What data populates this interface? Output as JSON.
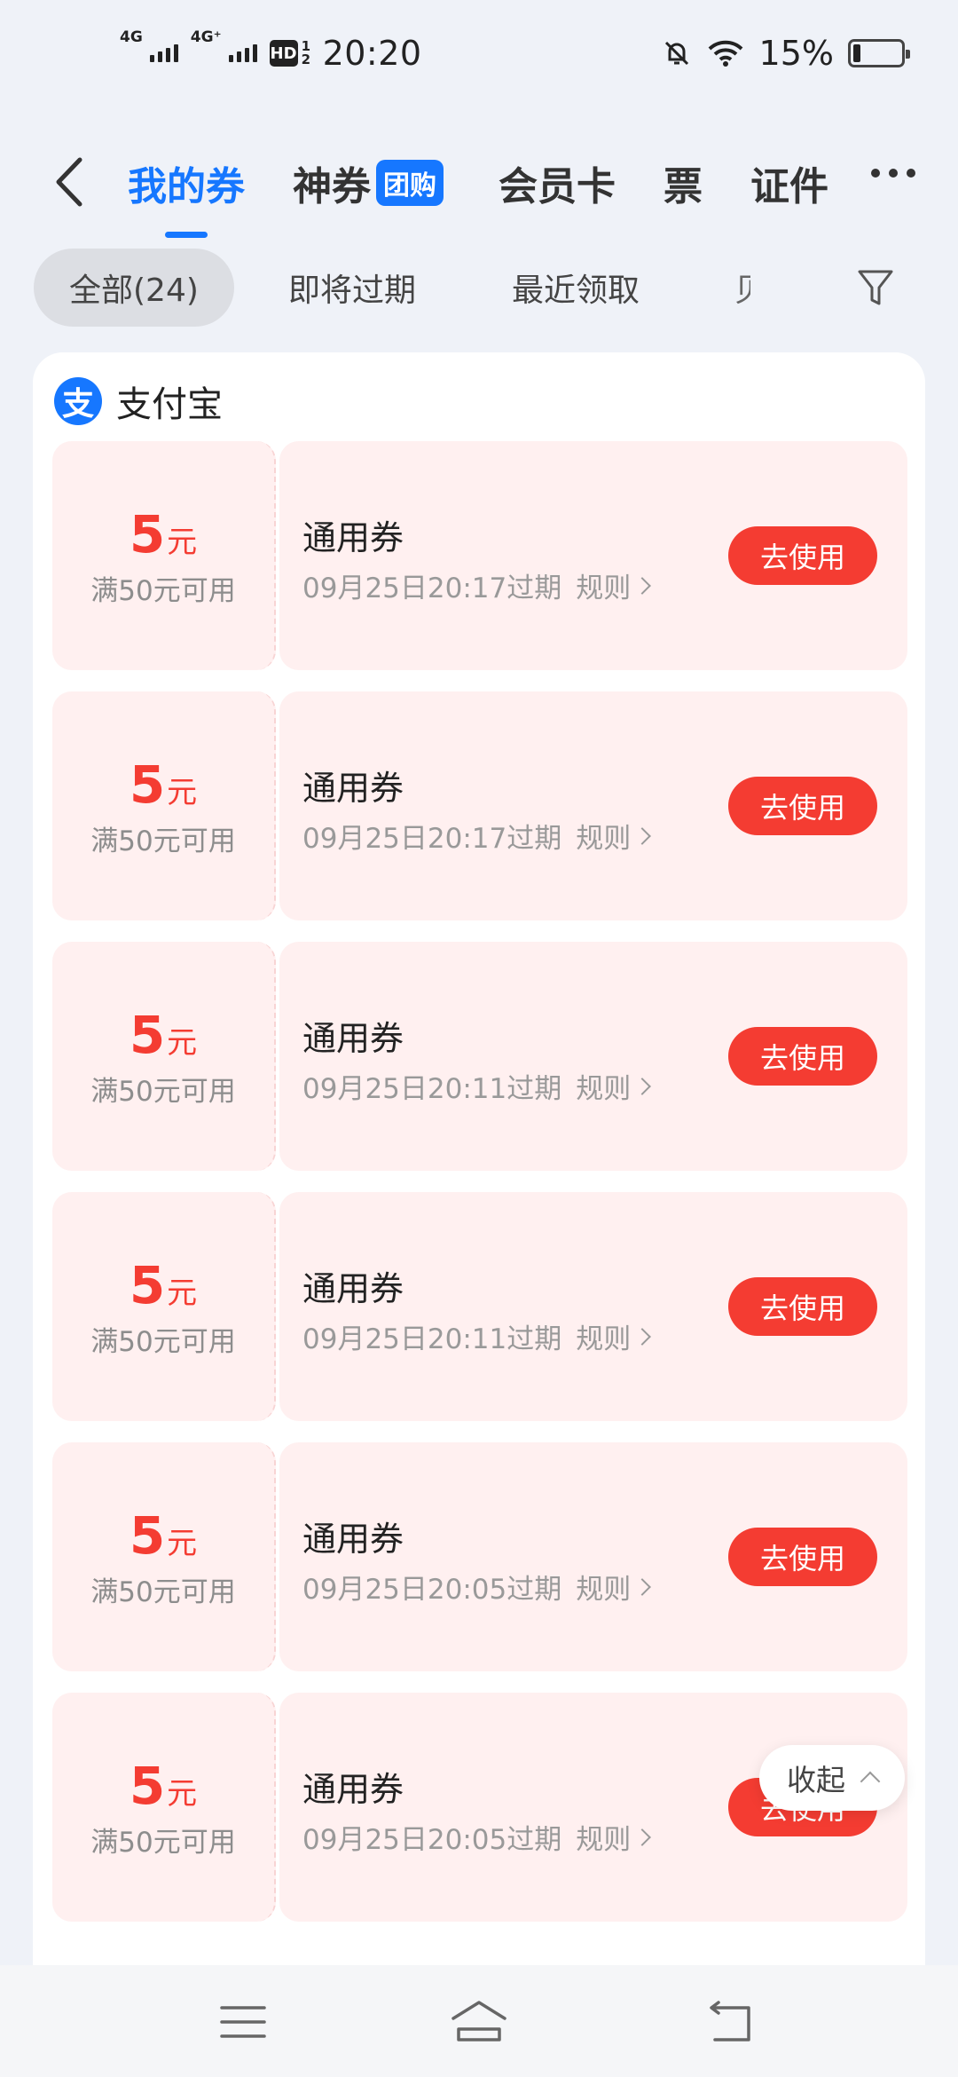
{
  "status_bar": {
    "net1": "4G",
    "net2": "4G⁺",
    "hd": "HD",
    "hd_sub": "1 2",
    "time": "20:20",
    "battery": "15%"
  },
  "nav": {
    "tabs": [
      {
        "label": "我的券"
      },
      {
        "label": "神券",
        "badge": "团购"
      },
      {
        "label": "会员卡"
      },
      {
        "label": "票"
      },
      {
        "label": "证件"
      }
    ]
  },
  "filters": [
    {
      "label": "全部(24)"
    },
    {
      "label": "即将过期"
    },
    {
      "label": "最近领取"
    },
    {
      "label": "贝"
    }
  ],
  "merchant": {
    "logo": "支",
    "name": "支付宝"
  },
  "coupons": [
    {
      "amount": "5",
      "unit": "元",
      "condition": "满50元可用",
      "title": "通用券",
      "expiry": "09月25日20:17过期",
      "rule": "规则",
      "action": "去使用"
    },
    {
      "amount": "5",
      "unit": "元",
      "condition": "满50元可用",
      "title": "通用券",
      "expiry": "09月25日20:17过期",
      "rule": "规则",
      "action": "去使用"
    },
    {
      "amount": "5",
      "unit": "元",
      "condition": "满50元可用",
      "title": "通用券",
      "expiry": "09月25日20:11过期",
      "rule": "规则",
      "action": "去使用"
    },
    {
      "amount": "5",
      "unit": "元",
      "condition": "满50元可用",
      "title": "通用券",
      "expiry": "09月25日20:11过期",
      "rule": "规则",
      "action": "去使用"
    },
    {
      "amount": "5",
      "unit": "元",
      "condition": "满50元可用",
      "title": "通用券",
      "expiry": "09月25日20:05过期",
      "rule": "规则",
      "action": "去使用"
    },
    {
      "amount": "5",
      "unit": "元",
      "condition": "满50元可用",
      "title": "通用券",
      "expiry": "09月25日20:05过期",
      "rule": "规则",
      "action": "去使用"
    }
  ],
  "collapse_label": "收起",
  "colors": {
    "accent": "#1677ff",
    "coupon_red": "#f43c32",
    "coupon_bg": "#fff0f0"
  }
}
